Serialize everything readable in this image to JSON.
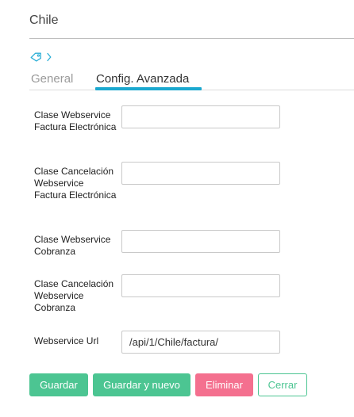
{
  "header": {
    "title": "Chile"
  },
  "breadcrumb": {
    "tag_icon": "tag-icon",
    "separator_icon": "chevron-right-icon"
  },
  "tabs": [
    {
      "label": "General",
      "active": false
    },
    {
      "label": "Config. Avanzada",
      "active": true
    }
  ],
  "form": {
    "fields": [
      {
        "label": "Clase Webservice Factura Electrónica",
        "value": ""
      },
      {
        "label": "Clase Cancelación Webservice Factura Electrónica",
        "value": ""
      },
      {
        "label": "Clase Webservice Cobranza",
        "value": ""
      },
      {
        "label": "Clase Cancelación Webservice Cobranza",
        "value": ""
      },
      {
        "label": "Webservice Url",
        "value": "/api/1/Chile/factura/"
      }
    ]
  },
  "actions": {
    "save": "Guardar",
    "save_new": "Guardar y nuevo",
    "delete": "Eliminar",
    "close": "Cerrar"
  },
  "colors": {
    "accent": "#1ba8cf",
    "success": "#4cc592",
    "danger": "#f4708f"
  }
}
